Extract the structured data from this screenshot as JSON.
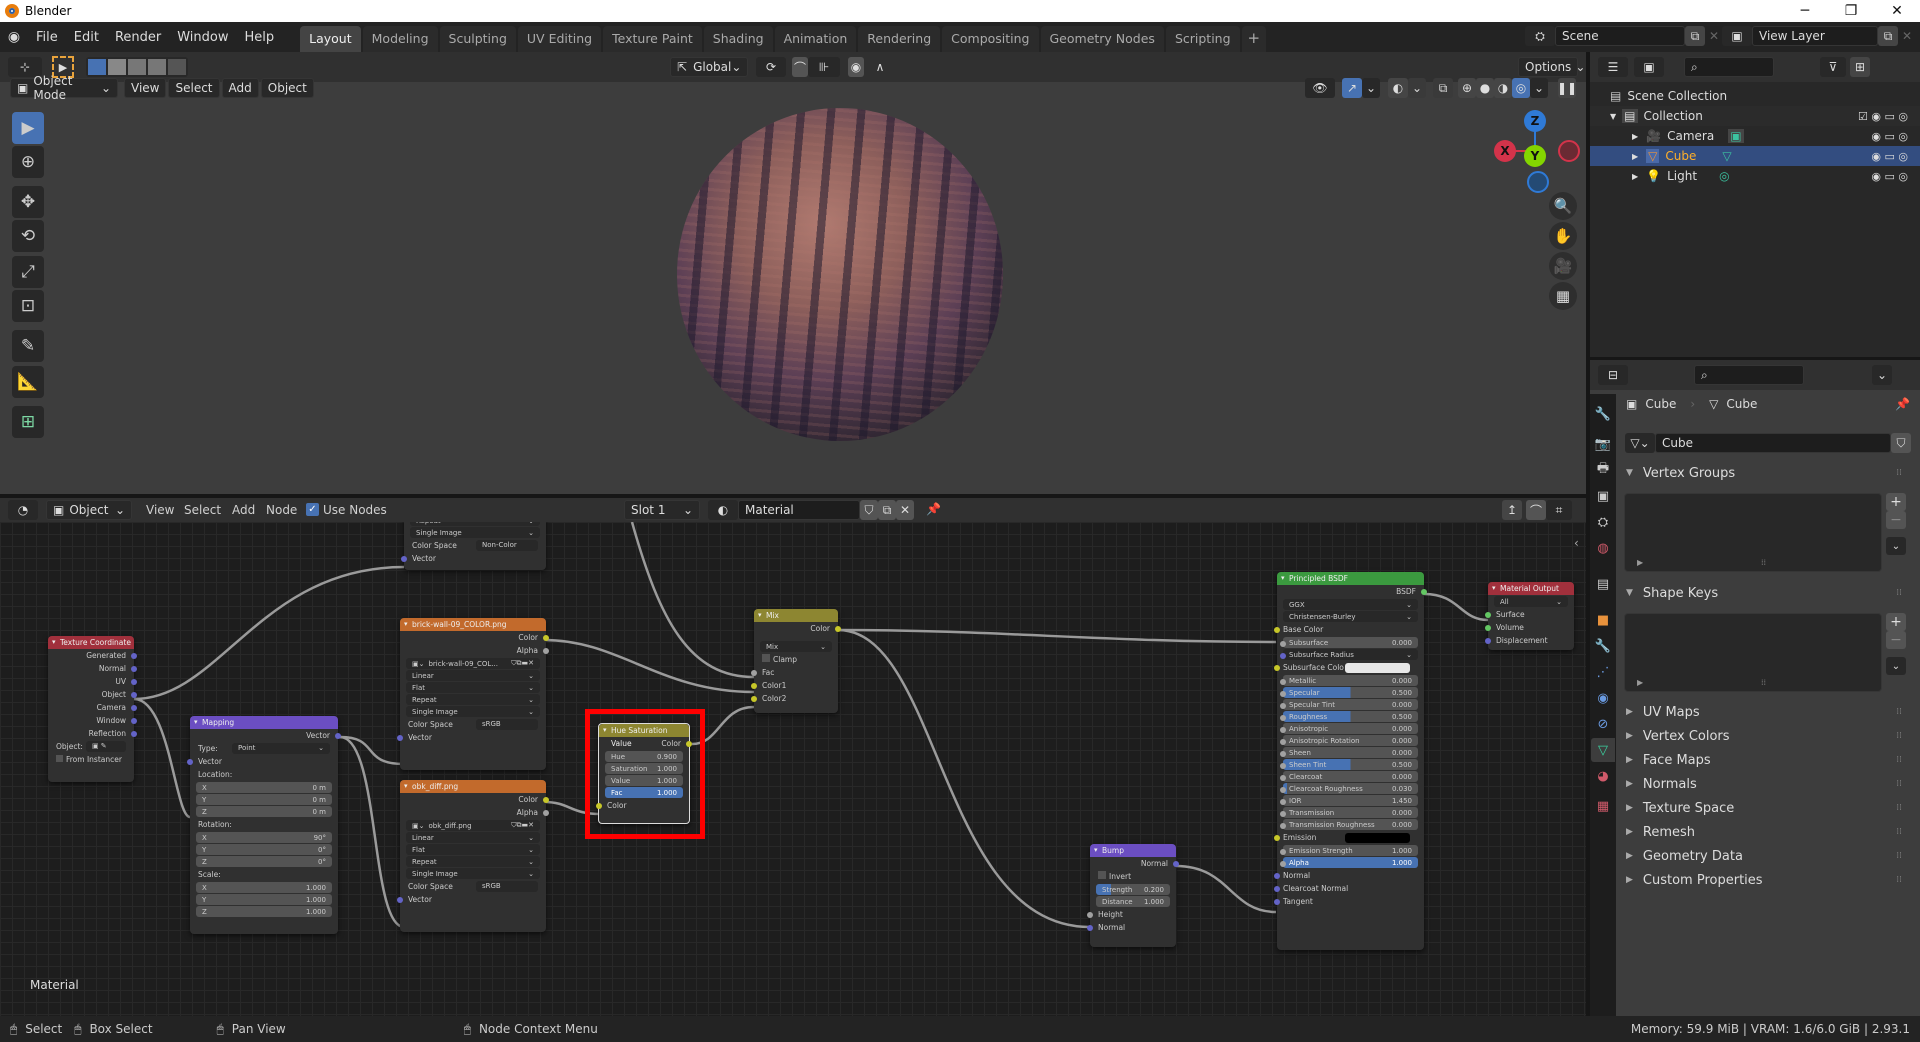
{
  "window": {
    "title": "Blender",
    "controls": [
      "minimize",
      "maximize",
      "close"
    ]
  },
  "menu": [
    "File",
    "Edit",
    "Render",
    "Window",
    "Help"
  ],
  "workspaces": [
    {
      "label": "Layout",
      "active": true
    },
    {
      "label": "Modeling"
    },
    {
      "label": "Sculpting"
    },
    {
      "label": "UV Editing"
    },
    {
      "label": "Texture Paint"
    },
    {
      "label": "Shading"
    },
    {
      "label": "Animation"
    },
    {
      "label": "Rendering"
    },
    {
      "label": "Compositing"
    },
    {
      "label": "Geometry Nodes"
    },
    {
      "label": "Scripting"
    }
  ],
  "scene": {
    "name": "Scene",
    "view_layer": "View Layer"
  },
  "viewport": {
    "transform_orientation": "Global",
    "options_label": "Options",
    "mode": "Object Mode",
    "menus": [
      "View",
      "Select",
      "Add",
      "Object"
    ],
    "gizmo_axes": {
      "x": "X",
      "y": "Y",
      "z": "Z"
    }
  },
  "outliner": {
    "root": "Scene Collection",
    "collection": "Collection",
    "items": [
      {
        "label": "Camera",
        "selected": false
      },
      {
        "label": "Cube",
        "selected": true
      },
      {
        "label": "Light",
        "selected": false
      }
    ]
  },
  "properties": {
    "breadcrumb": [
      "Cube",
      "Cube"
    ],
    "mesh_name": "Cube",
    "panels_open": [
      "Vertex Groups",
      "Shape Keys"
    ],
    "panels_closed": [
      "UV Maps",
      "Vertex Colors",
      "Face Maps",
      "Normals",
      "Texture Space",
      "Remesh",
      "Geometry Data",
      "Custom Properties"
    ]
  },
  "node_editor": {
    "type_label": "Object",
    "menus": [
      "View",
      "Select",
      "Add",
      "Node"
    ],
    "use_nodes_label": "Use Nodes",
    "use_nodes": true,
    "slot": "Slot 1",
    "material": "Material",
    "footer_label": "Material",
    "nodes": {
      "partial_image": {
        "rows": [
          "Repeat",
          "Single Image"
        ],
        "color_space_label": "Color Space",
        "color_space": "Non-Color",
        "vector": "Vector"
      },
      "tex_coord": {
        "title": "Texture Coordinate",
        "outputs": [
          "Generated",
          "Normal",
          "UV",
          "Object",
          "Camera",
          "Window",
          "Reflection"
        ],
        "object_label": "Object:",
        "from_instancer": "From Instancer"
      },
      "mapping": {
        "title": "Mapping",
        "output": "Vector",
        "type_label": "Type:",
        "type": "Point",
        "input": "Vector",
        "location_label": "Location:",
        "location": [
          "0 m",
          "0 m",
          "0 m"
        ],
        "rotation_label": "Rotation:",
        "rotation": [
          "90°",
          "0°",
          "0°"
        ],
        "scale_label": "Scale:",
        "scale": [
          "1.000",
          "1.000",
          "1.000"
        ],
        "axes": [
          "X",
          "Y",
          "Z"
        ]
      },
      "brick": {
        "title": "brick-wall-09_COLOR.png",
        "outputs": [
          "Color",
          "Alpha"
        ],
        "image": "brick-wall-09_COL...",
        "interp": "Linear",
        "proj": "Flat",
        "ext": "Repeat",
        "source": "Single Image",
        "color_space_label": "Color Space",
        "color_space": "sRGB",
        "input": "Vector"
      },
      "obk": {
        "title": "obk_diff.png",
        "outputs": [
          "Color",
          "Alpha"
        ],
        "image": "obk_diff.png",
        "interp": "Linear",
        "proj": "Flat",
        "ext": "Repeat",
        "source": "Single Image",
        "color_space_label": "Color Space",
        "color_space": "sRGB",
        "input": "Vector"
      },
      "hsv": {
        "title": "Hue Saturation Value",
        "output": "Color",
        "hue_label": "Hue",
        "hue": "0.900",
        "sat_label": "Saturation",
        "sat": "1.000",
        "val_label": "Value",
        "val": "1.000",
        "fac_label": "Fac",
        "fac": "1.000",
        "input": "Color"
      },
      "mix": {
        "title": "Mix",
        "output": "Color",
        "blend": "Mix",
        "clamp": "Clamp",
        "inputs": [
          "Fac",
          "Color1",
          "Color2"
        ]
      },
      "bump": {
        "title": "Bump",
        "output": "Normal",
        "invert": "Invert",
        "strength_label": "Strength",
        "strength": "0.200",
        "distance_label": "Distance",
        "distance": "1.000",
        "inputs": [
          "Height",
          "Normal"
        ]
      },
      "bsdf": {
        "title": "Principled BSDF",
        "output": "BSDF",
        "distribution": "GGX",
        "subsurface_method": "Christensen-Burley",
        "base_color": "Base Color",
        "fields": [
          {
            "label": "Subsurface",
            "value": "0.000",
            "fill": 0
          },
          {
            "label": "Subsurface Radius",
            "value": "",
            "dropdown": true
          },
          {
            "label": "Subsurface Colo",
            "value": "",
            "swatch": "#e8e8e8"
          },
          {
            "label": "Metallic",
            "value": "0.000",
            "fill": 0
          },
          {
            "label": "Specular",
            "value": "0.500",
            "fill": 0.5
          },
          {
            "label": "Specular Tint",
            "value": "0.000",
            "fill": 0
          },
          {
            "label": "Roughness",
            "value": "0.500",
            "fill": 0.5
          },
          {
            "label": "Anisotropic",
            "value": "0.000",
            "fill": 0
          },
          {
            "label": "Anisotropic Rotation",
            "value": "0.000",
            "fill": 0
          },
          {
            "label": "Sheen",
            "value": "0.000",
            "fill": 0
          },
          {
            "label": "Sheen Tint",
            "value": "0.500",
            "fill": 0.5
          },
          {
            "label": "Clearcoat",
            "value": "0.000",
            "fill": 0
          },
          {
            "label": "Clearcoat Roughness",
            "value": "0.030",
            "fill": 0.03
          },
          {
            "label": "IOR",
            "value": "1.450",
            "fill": 0
          },
          {
            "label": "Transmission",
            "value": "0.000",
            "fill": 0
          },
          {
            "label": "Transmission Roughness",
            "value": "0.000",
            "fill": 0
          },
          {
            "label": "Emission",
            "value": "",
            "swatch": "#000000"
          },
          {
            "label": "Emission Strength",
            "value": "1.000",
            "fill": 0
          },
          {
            "label": "Alpha",
            "value": "1.000",
            "fill": 1
          }
        ],
        "vector_inputs": [
          "Normal",
          "Clearcoat Normal",
          "Tangent"
        ]
      },
      "output": {
        "title": "Material Output",
        "target": "All",
        "inputs": [
          "Surface",
          "Volume",
          "Displacement"
        ]
      }
    }
  },
  "statusbar": {
    "hints": [
      "Select",
      "Box Select",
      "Pan View",
      "Node Context Menu"
    ],
    "info": "Memory: 59.9 MiB | VRAM: 1.6/6.0 GiB | 2.93.1"
  },
  "colors": {
    "accent": "#4772b3",
    "highlight": "#ff0000",
    "selected_text": "#ffaf29"
  }
}
